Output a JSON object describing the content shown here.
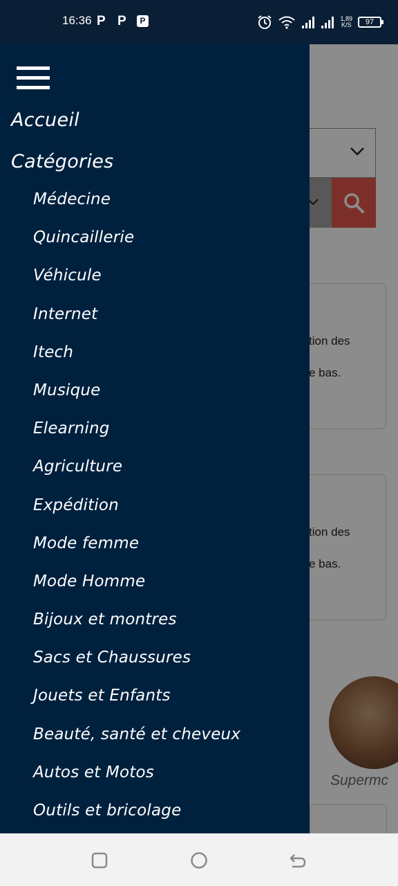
{
  "status_bar": {
    "time": "16:36",
    "notification_icons": [
      "P",
      "P",
      "P"
    ],
    "network_speed_value": "1,89",
    "network_speed_unit": "K/S",
    "battery": "97",
    "icons": [
      "alarm-icon",
      "wifi-icon",
      "signal-icon",
      "signal-icon",
      "battery-icon"
    ]
  },
  "drawer": {
    "menu_icon": "hamburger-icon",
    "home_label": "Accueil",
    "categories_label": "Catégories",
    "categories": [
      "Médecine",
      "Quincaillerie",
      "Véhicule",
      "Internet",
      "Itech",
      "Musique",
      "Elearning",
      "Agriculture",
      "Expédition",
      "Mode femme",
      "Mode Homme",
      "Bijoux et montres",
      "Sacs et Chaussures",
      "Jouets et Enfants",
      "Beauté, santé et cheveux",
      "Autos et Motos",
      "Outils et bricolage"
    ]
  },
  "background_page": {
    "cards": [
      {
        "line1": "tion des",
        "line2": "e bas."
      },
      {
        "line1": "tion des",
        "line2": "e bas."
      }
    ],
    "store_label": "Supermc"
  },
  "colors": {
    "drawer_bg": "#00213e",
    "status_bar_bg": "#0a1f35",
    "search_button": "#e2574c"
  },
  "nav_bar": {
    "icons": [
      "recent-apps-icon",
      "home-icon",
      "back-icon"
    ]
  }
}
